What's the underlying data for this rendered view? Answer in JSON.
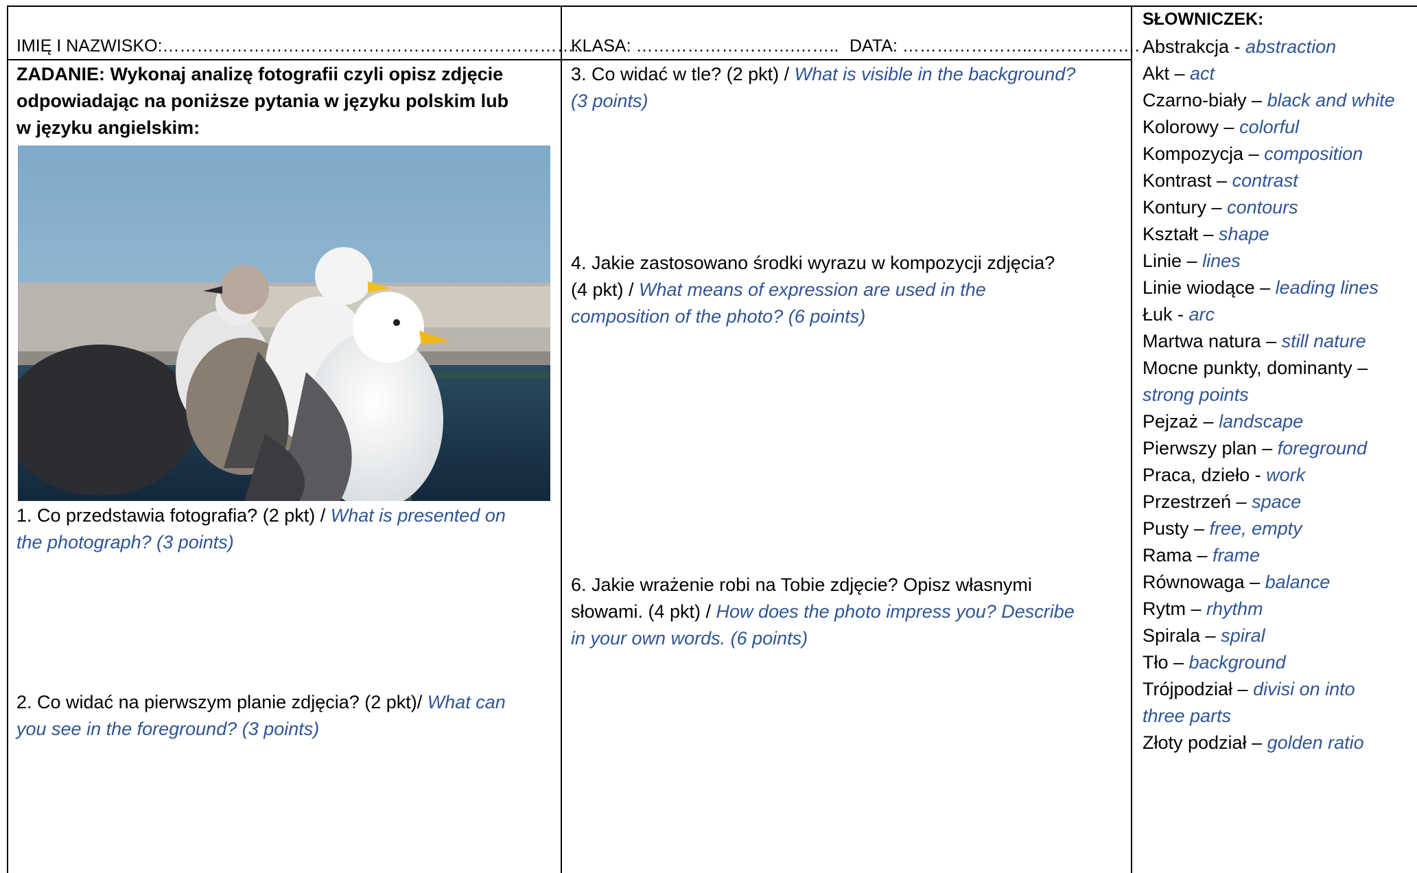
{
  "header": {
    "name_field": "IMIĘ I NAZWISKO:……………………………………………………………….",
    "class_field": "KLASA: ……………………….……..",
    "date_field": "DATA: …………………..……………….",
    "glossary_title": "SŁOWNICZEK:"
  },
  "task": {
    "lines": [
      "ZADANIE: Wykonaj analizę fotografii czyli opisz zdjęcie",
      "odpowiadając na poniższe pytania w języku polskim lub",
      "w języku angielskim:"
    ]
  },
  "photo": {
    "description": "Seagulls perched on a railing by the water",
    "colors": {
      "sky": "#8fb4cf",
      "water": "#1e3a4f"
    }
  },
  "questions": {
    "q1": {
      "l1_pl": "1. Co przedstawia fotografia? (2 pkt) / ",
      "l1_en": "What is presented on",
      "l2_en": "the photograph? (3 points)"
    },
    "q2": {
      "l1_pl": "2. Co widać na pierwszym planie zdjęcia? (2 pkt)/ ",
      "l1_en": "What can",
      "l2_en": "you see in the foreground? (3 points)"
    },
    "q3": {
      "l1_pl": "3. Co widać w tle? (2 pkt) / ",
      "l1_en": "What is visible in the background?",
      "l2_en": "(3 points)"
    },
    "q4": {
      "l1_pl": "4. Jakie zastosowano środki wyrazu w kompozycji zdjęcia?",
      "l2_pl": "(4 pkt) / ",
      "l2_en": "What means of expression are used in the",
      "l3_en": "composition of the photo? (6 points)"
    },
    "q6": {
      "l1_pl": "6. Jakie wrażenie robi na Tobie zdjęcie? Opisz własnymi",
      "l2_pl": "słowami. (4 pkt) / ",
      "l2_en": "How does the photo impress you? Describe",
      "l3_en": "in your own words. (6 points)"
    }
  },
  "glossary": [
    {
      "pl": "Abstrakcja - ",
      "en": "abstraction"
    },
    {
      "pl": "Akt – ",
      "en": "act"
    },
    {
      "pl": "Czarno-biały – ",
      "en": "black and white"
    },
    {
      "pl": "Kolorowy – ",
      "en": "colorful"
    },
    {
      "pl": "Kompozycja – ",
      "en": "composition"
    },
    {
      "pl": "Kontrast – ",
      "en": "contrast"
    },
    {
      "pl": "Kontury – ",
      "en": "contours"
    },
    {
      "pl": "Kształt – ",
      "en": "shape"
    },
    {
      "pl": "Linie – ",
      "en": "lines"
    },
    {
      "pl": "Linie wiodące – ",
      "en": "leading lines"
    },
    {
      "pl": "Łuk - ",
      "en": "arc"
    },
    {
      "pl": "Martwa natura – ",
      "en": "still nature"
    },
    {
      "pl": "Mocne punkty, dominanty –",
      "en": ""
    },
    {
      "pl": "",
      "en": "strong points"
    },
    {
      "pl": "Pejzaż – ",
      "en": "landscape"
    },
    {
      "pl": "Pierwszy plan – ",
      "en": "foreground"
    },
    {
      "pl": "Praca, dzieło - ",
      "en": "work"
    },
    {
      "pl": "Przestrzeń – ",
      "en": "space"
    },
    {
      "pl": "Pusty – ",
      "en": "free, empty"
    },
    {
      "pl": "Rama – ",
      "en": "frame"
    },
    {
      "pl": "Równowaga – ",
      "en": "balance"
    },
    {
      "pl": "Rytm – ",
      "en": "rhythm"
    },
    {
      "pl": "Spirala – ",
      "en": "spiral"
    },
    {
      "pl": "Tło – ",
      "en": "background"
    },
    {
      "pl": "Trójpodział – ",
      "en": "divisi on into"
    },
    {
      "pl": "",
      "en": "three parts"
    },
    {
      "pl": "Złoty podział – ",
      "en": "golden ratio"
    }
  ]
}
